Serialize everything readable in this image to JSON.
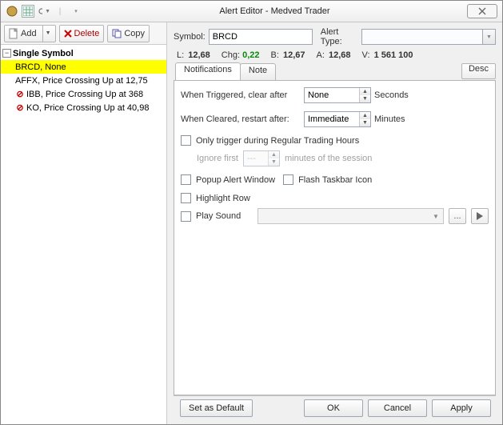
{
  "titlebar": {
    "title": "Alert Editor - Medved Trader"
  },
  "toolbar": {
    "add": "Add",
    "delete": "Delete",
    "copy": "Copy"
  },
  "tree": {
    "header": "Single Symbol",
    "items": [
      {
        "text": "BRCD, None",
        "selected": true,
        "forbidden": false
      },
      {
        "text": "AFFX, Price Crossing Up at 12,75",
        "selected": false,
        "forbidden": false
      },
      {
        "text": "IBB, Price Crossing Up at 368",
        "selected": false,
        "forbidden": true
      },
      {
        "text": "KO, Price Crossing Up at 40,98",
        "selected": false,
        "forbidden": true
      }
    ]
  },
  "form": {
    "symbol_label": "Symbol:",
    "symbol_value": "BRCD",
    "alerttype_label": "Alert Type:",
    "alerttype_value": "",
    "desc_button": "Desc"
  },
  "quotes": {
    "L_label": "L:",
    "L": "12,68",
    "Chg_label": "Chg:",
    "Chg": "0,22",
    "B_label": "B:",
    "B": "12,67",
    "A_label": "A:",
    "A": "12,68",
    "V_label": "V:",
    "V": "1 561 100"
  },
  "tabs": {
    "notifications": "Notifications",
    "note": "Note"
  },
  "notifications": {
    "triggered_label": "When Triggered, clear after",
    "triggered_value": "None",
    "triggered_unit": "Seconds",
    "cleared_label": "When Cleared, restart after:",
    "cleared_value": "Immediate",
    "cleared_unit": "Minutes",
    "regular_hours": "Only trigger during Regular Trading Hours",
    "ignore_first": "Ignore first",
    "ignore_value": "---",
    "ignore_unit": "minutes of the session",
    "popup": "Popup Alert Window",
    "flash": "Flash Taskbar Icon",
    "highlight": "Highlight Row",
    "play_sound": "Play Sound",
    "browse": "..."
  },
  "footer": {
    "default": "Set as Default",
    "ok": "OK",
    "cancel": "Cancel",
    "apply": "Apply"
  }
}
